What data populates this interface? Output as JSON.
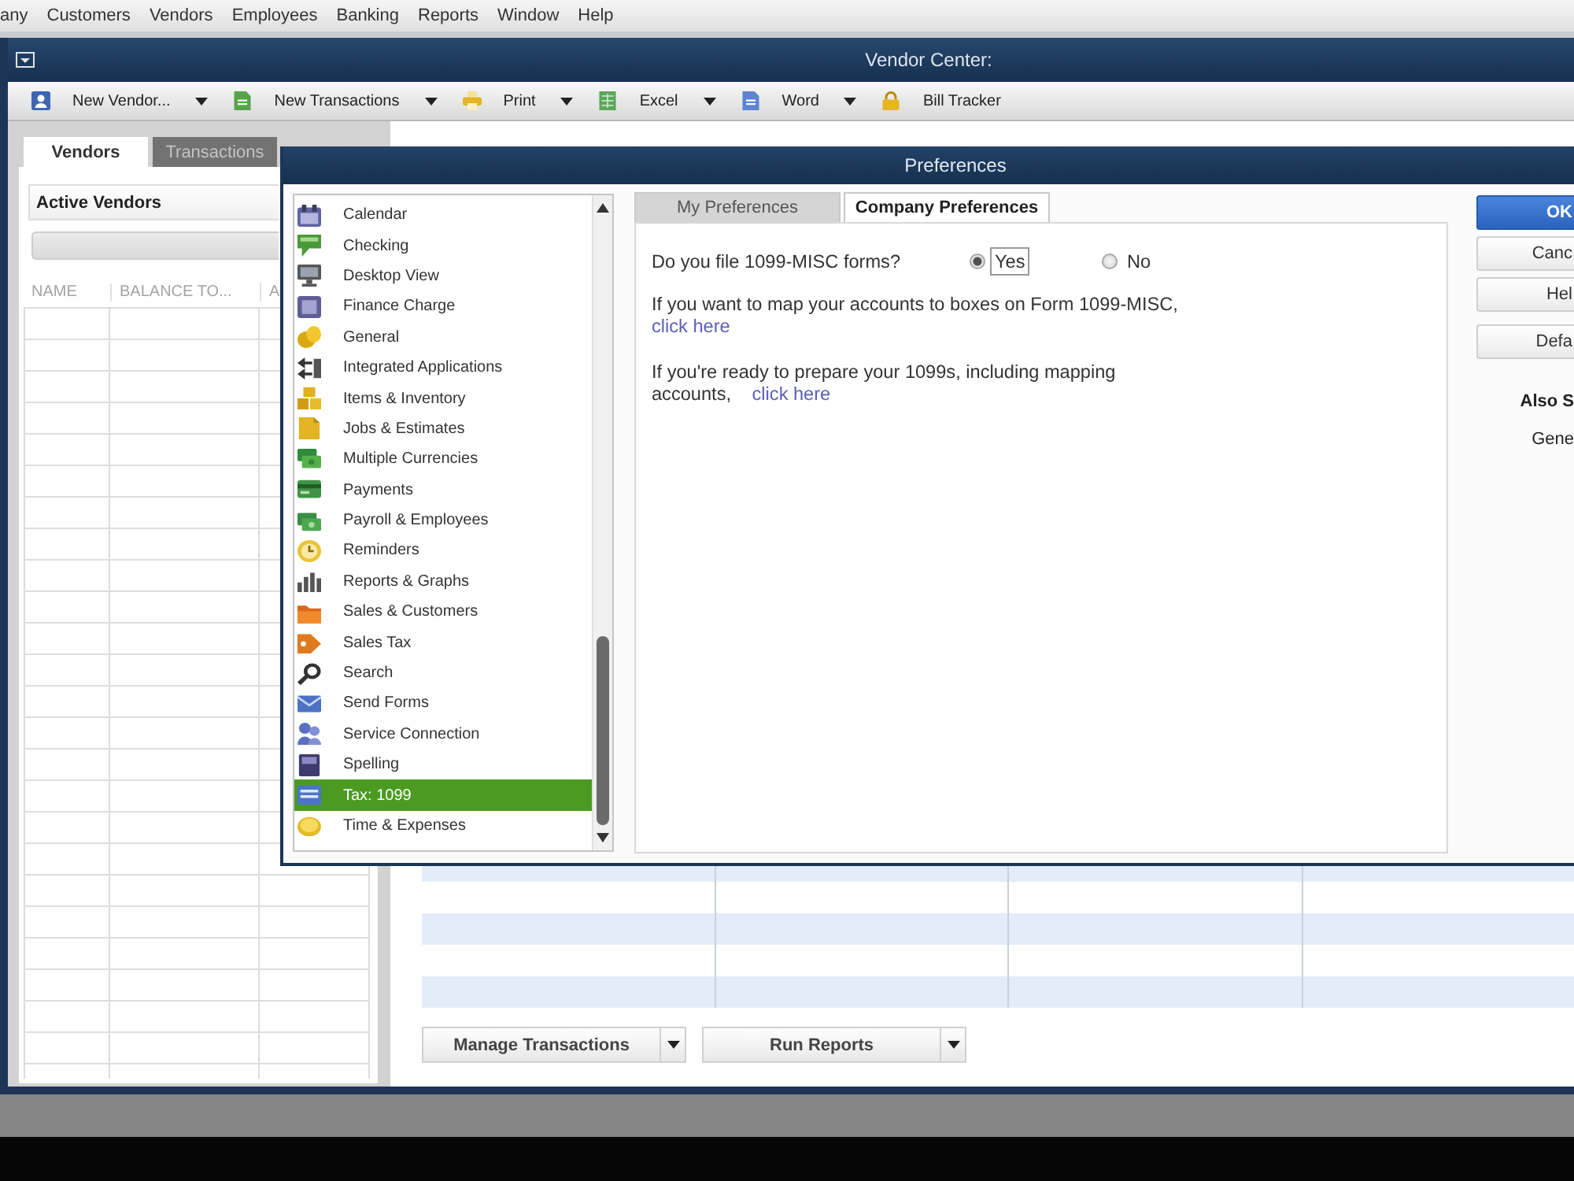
{
  "menu_bar": {
    "items": [
      "any",
      "Customers",
      "Vendors",
      "Employees",
      "Banking",
      "Reports",
      "Window",
      "Help"
    ]
  },
  "window": {
    "title": "Vendor Center:"
  },
  "toolbar": {
    "items": [
      {
        "label": "New Vendor...",
        "dropdown": true
      },
      {
        "label": "New Transactions",
        "dropdown": true
      },
      {
        "label": "Print",
        "dropdown": true
      },
      {
        "label": "Excel",
        "dropdown": true
      },
      {
        "label": "Word",
        "dropdown": true
      },
      {
        "label": "Bill Tracker",
        "dropdown": false
      }
    ]
  },
  "vendor_panel": {
    "tabs": [
      {
        "label": "Vendors",
        "selected": true
      },
      {
        "label": "Transactions",
        "selected": false
      }
    ],
    "filter": "Active Vendors",
    "columns": [
      "NAME",
      "BALANCE TO...",
      "A"
    ]
  },
  "transactions_panel": {
    "buttons": [
      {
        "label": "Manage Transactions",
        "dropdown": true
      },
      {
        "label": "Run Reports",
        "dropdown": true
      }
    ]
  },
  "preferences_dialog": {
    "title": "Preferences",
    "categories": [
      {
        "label": "Calendar",
        "selected": false
      },
      {
        "label": "Checking",
        "selected": false
      },
      {
        "label": "Desktop View",
        "selected": false
      },
      {
        "label": "Finance Charge",
        "selected": false
      },
      {
        "label": "General",
        "selected": false
      },
      {
        "label": "Integrated Applications",
        "selected": false
      },
      {
        "label": "Items & Inventory",
        "selected": false
      },
      {
        "label": "Jobs & Estimates",
        "selected": false
      },
      {
        "label": "Multiple Currencies",
        "selected": false
      },
      {
        "label": "Payments",
        "selected": false
      },
      {
        "label": "Payroll & Employees",
        "selected": false
      },
      {
        "label": "Reminders",
        "selected": false
      },
      {
        "label": "Reports & Graphs",
        "selected": false
      },
      {
        "label": "Sales & Customers",
        "selected": false
      },
      {
        "label": "Sales Tax",
        "selected": false
      },
      {
        "label": "Search",
        "selected": false
      },
      {
        "label": "Send Forms",
        "selected": false
      },
      {
        "label": "Service Connection",
        "selected": false
      },
      {
        "label": "Spelling",
        "selected": false
      },
      {
        "label": "Tax: 1099",
        "selected": true
      },
      {
        "label": "Time & Expenses",
        "selected": false
      }
    ],
    "tabs": [
      {
        "label": "My Preferences",
        "selected": false
      },
      {
        "label": "Company Preferences",
        "selected": true
      }
    ],
    "question": {
      "label": "Do you file 1099-MISC forms?",
      "options": [
        {
          "label": "Yes",
          "selected": true,
          "focused": true
        },
        {
          "label": "No",
          "selected": false,
          "focused": false
        }
      ]
    },
    "paragraphs": [
      {
        "text": "If you want to map your accounts to boxes on Form 1099-MISC,",
        "link": "click here"
      },
      {
        "text": "If you're ready to prepare your 1099s, including mapping accounts,",
        "link": "click here"
      }
    ],
    "buttons": [
      {
        "label": "OK",
        "kind": "primary"
      },
      {
        "label": "Canc",
        "kind": "default"
      },
      {
        "label": "Hel",
        "kind": "default"
      },
      {
        "label": "Defa",
        "kind": "default"
      }
    ],
    "also_see": {
      "heading": "Also S",
      "items": [
        "Gene"
      ]
    }
  }
}
